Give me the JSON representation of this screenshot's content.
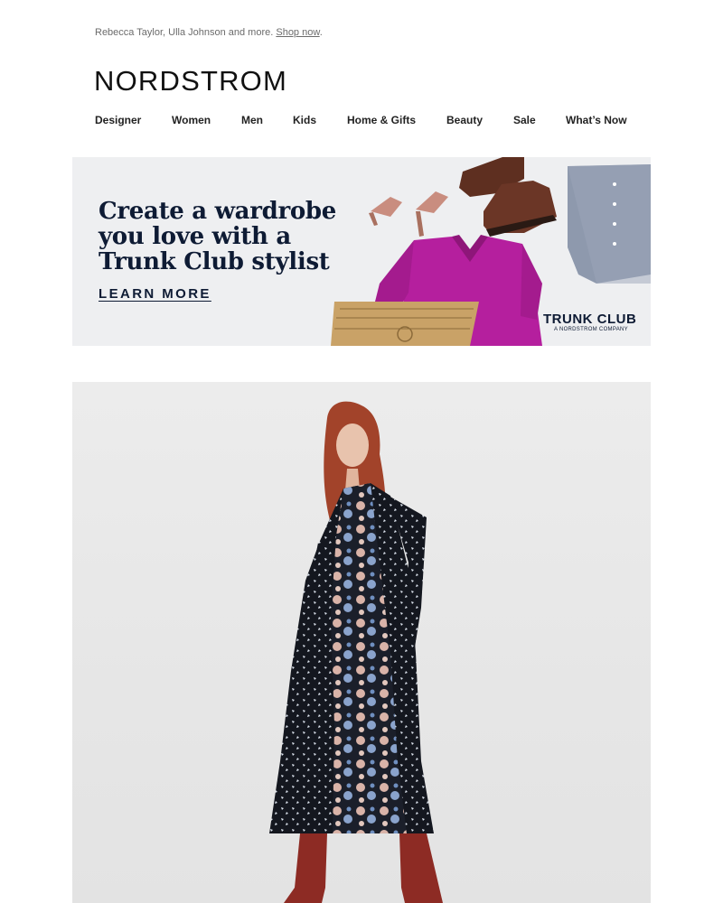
{
  "preheader": {
    "text": "Rebecca Taylor, Ulla Johnson and more. ",
    "link_label": "Shop now",
    "suffix": "."
  },
  "brand": {
    "logo_text": "NORDSTROM"
  },
  "nav": {
    "items": [
      {
        "label": "Designer"
      },
      {
        "label": "Women"
      },
      {
        "label": "Men"
      },
      {
        "label": "Kids"
      },
      {
        "label": "Home & Gifts"
      },
      {
        "label": "Beauty"
      },
      {
        "label": "Sale"
      },
      {
        "label": "What’s Now"
      }
    ]
  },
  "banner": {
    "headline_lines": [
      "Create a wardrobe",
      "you love with a",
      "Trunk Club stylist"
    ],
    "cta_label": "LEARN MORE",
    "brand_name": "TRUNK CLUB",
    "brand_tagline": "A NORDSTROM COMPANY",
    "colors": {
      "navy": "#0e1b34",
      "sweater": "#b51f9e",
      "shoe_pink": "#c98d7f",
      "boot_brown": "#6b3626",
      "box_kraft": "#c9a267",
      "shirt_blue": "#8e99ad"
    }
  },
  "hero": {
    "colors": {
      "background": "#e7e7e7",
      "hair": "#a2432a",
      "dress_dark": "#14171f",
      "boots": "#8d2b24"
    }
  }
}
